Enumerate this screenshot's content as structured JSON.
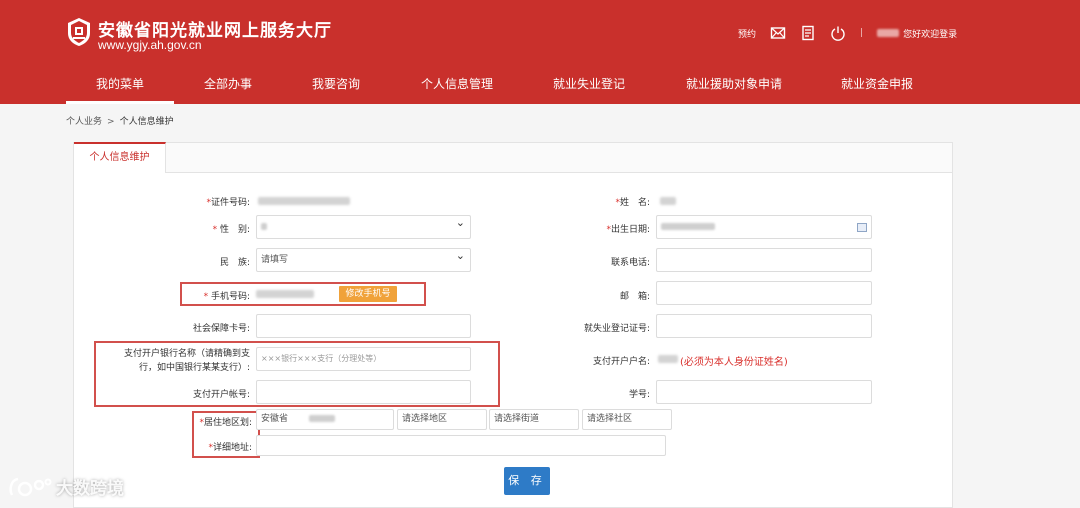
{
  "site": {
    "title": "安徽省阳光就业网上服务大厅",
    "url": "www.ygjy.ah.gov.cn"
  },
  "toolbar": {
    "appointment": "预约",
    "welcome": "您好欢迎登录",
    "icons": [
      "mail-icon",
      "document-icon",
      "power-icon"
    ]
  },
  "nav": {
    "items": [
      {
        "label": "我的菜单",
        "active": true
      },
      {
        "label": "全部办事",
        "active": false
      },
      {
        "label": "我要咨询",
        "active": false
      },
      {
        "label": "个人信息管理",
        "active": false
      },
      {
        "label": "就业失业登记",
        "active": false
      },
      {
        "label": "就业援助对象申请",
        "active": false
      },
      {
        "label": "就业资金申报",
        "active": false
      }
    ]
  },
  "breadcrumb": {
    "parent": "个人业务",
    "separator": ">",
    "current": "个人信息维护"
  },
  "panel": {
    "tab": "个人信息维护"
  },
  "form": {
    "id_number_label": "*证件号码:",
    "name_label": "*姓　名:",
    "gender_label": "* 性　别:",
    "birth_label": "*出生日期:",
    "ethnicity_label": "民　族:",
    "ethnicity_value": "请填写",
    "phone_contact_label": "联系电话:",
    "mobile_label": "* 手机号码:",
    "change_mobile_button": "修改手机号",
    "email_label": "邮　箱:",
    "social_card_label": "社会保障卡号:",
    "employment_reg_label": "就失业登记证号:",
    "bank_name_label_line1": "支付开户银行名称（请精确到支",
    "bank_name_label_line2": "行，如中国银行某某支行）:",
    "bank_name_placeholder": "×××银行×××支行（分理处等）",
    "account_holder_label": "支付开户户名:",
    "account_holder_note": "(必须为本人身份证姓名)",
    "bank_account_label": "支付开户帐号:",
    "student_id_label": "学号:",
    "residence_label": "*居住地区划:",
    "province_value": "安徽省",
    "district_placeholder": "请选择地区",
    "street_placeholder": "请选择街道",
    "community_placeholder": "请选择社区",
    "address_label": "*详细地址:",
    "save_button": "保 存"
  },
  "watermark": {
    "text": "大数跨境"
  },
  "colors": {
    "brand_red": "#c9302c",
    "highlight_border": "#d2504c",
    "change_button": "#f0a23a",
    "save_button": "#2e7bc7",
    "required_star": "#d9302c"
  }
}
